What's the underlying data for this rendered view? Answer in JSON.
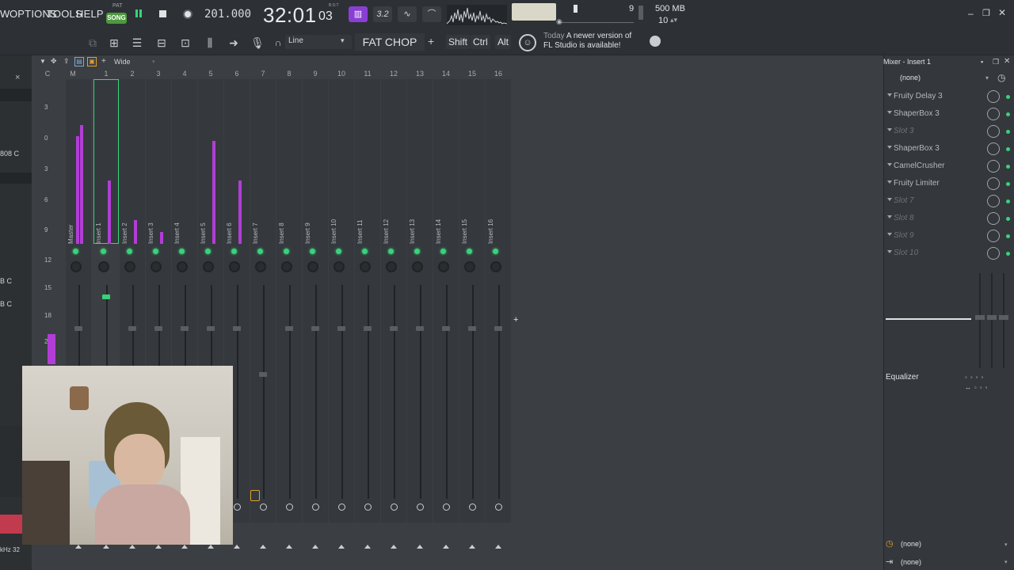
{
  "menu": {
    "view_partial": "W",
    "options": "OPTIONS",
    "tools": "TOOLS",
    "help": "HELP"
  },
  "transport": {
    "song_label": "SONG",
    "pattern_label": "PAT",
    "bpm": "201.000",
    "time_main": "32:01",
    "time_sub": "03",
    "time_unit": "B:S:T",
    "mode_icons": [
      "m-icon",
      "3.2-icon",
      "wave-icon",
      "curve-icon"
    ],
    "cpu_value": "9",
    "memory_value": "500 MB",
    "poly_value": "10"
  },
  "toolbar2": {
    "snap": "Line",
    "preset_name": "FAT CHOP",
    "keys": [
      "Shift",
      "Ctrl",
      "Alt"
    ],
    "news_date": "Today",
    "news_line1": "A newer version of",
    "news_line2": "FL Studio is available!"
  },
  "leftpanel": {
    "close": "×",
    "text1": "808 C",
    "text2": "B C",
    "text3": "B C",
    "text4": "kHz 32"
  },
  "mixer": {
    "view_mode": "Wide",
    "scale_marks": [
      "3",
      "0",
      "3",
      "6",
      "9",
      "12",
      "15",
      "18",
      "2"
    ],
    "header_cols": [
      "C",
      "M"
    ],
    "channel_numbers": [
      "1",
      "2",
      "3",
      "4",
      "5",
      "6",
      "7",
      "8",
      "9",
      "10",
      "11",
      "12",
      "13",
      "14",
      "15",
      "16"
    ],
    "strips": [
      "Master",
      "Insert 1",
      "Insert 2",
      "Insert 3",
      "Insert 4",
      "Insert 5",
      "Insert 6",
      "Insert 7",
      "Insert 8",
      "Insert 9",
      "Insert 10",
      "Insert 11",
      "Insert 12",
      "Insert 13",
      "Insert 14",
      "Insert 15",
      "Insert 16"
    ]
  },
  "rightpanel": {
    "title": "Mixer - Insert 1",
    "input": "(none)",
    "slots": [
      {
        "name": "Fruity Delay 3",
        "empty": false
      },
      {
        "name": "ShaperBox 3",
        "empty": false
      },
      {
        "name": "Slot 3",
        "empty": true
      },
      {
        "name": "ShaperBox 3",
        "empty": false
      },
      {
        "name": "CamelCrusher",
        "empty": false
      },
      {
        "name": "Fruity Limiter",
        "empty": false
      },
      {
        "name": "Slot 7",
        "empty": true
      },
      {
        "name": "Slot 8",
        "empty": true
      },
      {
        "name": "Slot 9",
        "empty": true
      },
      {
        "name": "Slot 10",
        "empty": true
      }
    ],
    "equalizer": "Equalizer",
    "output1": "(none)",
    "output2": "(none)"
  },
  "colors": {
    "accent_green": "#37d37a",
    "meter_purple": "#b23dd6",
    "song_green": "#4c9a3c"
  }
}
